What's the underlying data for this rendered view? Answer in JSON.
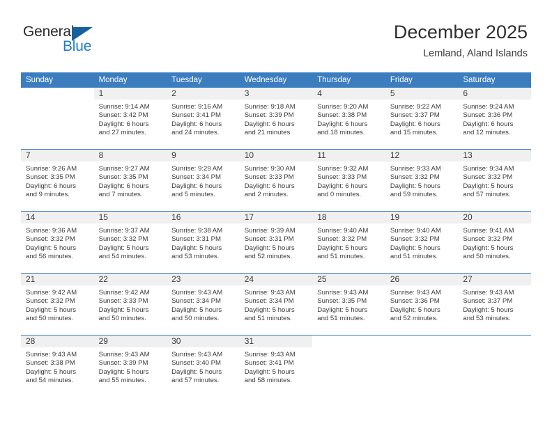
{
  "brand": {
    "name_part1": "General",
    "name_part2": "Blue",
    "triangle_color": "#17609d",
    "blue_color": "#1f7fc4"
  },
  "header": {
    "title": "December 2025",
    "subtitle": "Lemland, Aland Islands",
    "header_bg_color": "#3b7dbf"
  },
  "weekdays": [
    "Sunday",
    "Monday",
    "Tuesday",
    "Wednesday",
    "Thursday",
    "Friday",
    "Saturday"
  ],
  "weeks": [
    [
      {
        "day": ""
      },
      {
        "day": "1",
        "sunrise": "Sunrise: 9:14 AM",
        "sunset": "Sunset: 3:42 PM",
        "daylight1": "Daylight: 6 hours",
        "daylight2": "and 27 minutes."
      },
      {
        "day": "2",
        "sunrise": "Sunrise: 9:16 AM",
        "sunset": "Sunset: 3:41 PM",
        "daylight1": "Daylight: 6 hours",
        "daylight2": "and 24 minutes."
      },
      {
        "day": "3",
        "sunrise": "Sunrise: 9:18 AM",
        "sunset": "Sunset: 3:39 PM",
        "daylight1": "Daylight: 6 hours",
        "daylight2": "and 21 minutes."
      },
      {
        "day": "4",
        "sunrise": "Sunrise: 9:20 AM",
        "sunset": "Sunset: 3:38 PM",
        "daylight1": "Daylight: 6 hours",
        "daylight2": "and 18 minutes."
      },
      {
        "day": "5",
        "sunrise": "Sunrise: 9:22 AM",
        "sunset": "Sunset: 3:37 PM",
        "daylight1": "Daylight: 6 hours",
        "daylight2": "and 15 minutes."
      },
      {
        "day": "6",
        "sunrise": "Sunrise: 9:24 AM",
        "sunset": "Sunset: 3:36 PM",
        "daylight1": "Daylight: 6 hours",
        "daylight2": "and 12 minutes."
      }
    ],
    [
      {
        "day": "7",
        "sunrise": "Sunrise: 9:26 AM",
        "sunset": "Sunset: 3:35 PM",
        "daylight1": "Daylight: 6 hours",
        "daylight2": "and 9 minutes."
      },
      {
        "day": "8",
        "sunrise": "Sunrise: 9:27 AM",
        "sunset": "Sunset: 3:35 PM",
        "daylight1": "Daylight: 6 hours",
        "daylight2": "and 7 minutes."
      },
      {
        "day": "9",
        "sunrise": "Sunrise: 9:29 AM",
        "sunset": "Sunset: 3:34 PM",
        "daylight1": "Daylight: 6 hours",
        "daylight2": "and 5 minutes."
      },
      {
        "day": "10",
        "sunrise": "Sunrise: 9:30 AM",
        "sunset": "Sunset: 3:33 PM",
        "daylight1": "Daylight: 6 hours",
        "daylight2": "and 2 minutes."
      },
      {
        "day": "11",
        "sunrise": "Sunrise: 9:32 AM",
        "sunset": "Sunset: 3:33 PM",
        "daylight1": "Daylight: 6 hours",
        "daylight2": "and 0 minutes."
      },
      {
        "day": "12",
        "sunrise": "Sunrise: 9:33 AM",
        "sunset": "Sunset: 3:32 PM",
        "daylight1": "Daylight: 5 hours",
        "daylight2": "and 59 minutes."
      },
      {
        "day": "13",
        "sunrise": "Sunrise: 9:34 AM",
        "sunset": "Sunset: 3:32 PM",
        "daylight1": "Daylight: 5 hours",
        "daylight2": "and 57 minutes."
      }
    ],
    [
      {
        "day": "14",
        "sunrise": "Sunrise: 9:36 AM",
        "sunset": "Sunset: 3:32 PM",
        "daylight1": "Daylight: 5 hours",
        "daylight2": "and 56 minutes."
      },
      {
        "day": "15",
        "sunrise": "Sunrise: 9:37 AM",
        "sunset": "Sunset: 3:32 PM",
        "daylight1": "Daylight: 5 hours",
        "daylight2": "and 54 minutes."
      },
      {
        "day": "16",
        "sunrise": "Sunrise: 9:38 AM",
        "sunset": "Sunset: 3:31 PM",
        "daylight1": "Daylight: 5 hours",
        "daylight2": "and 53 minutes."
      },
      {
        "day": "17",
        "sunrise": "Sunrise: 9:39 AM",
        "sunset": "Sunset: 3:31 PM",
        "daylight1": "Daylight: 5 hours",
        "daylight2": "and 52 minutes."
      },
      {
        "day": "18",
        "sunrise": "Sunrise: 9:40 AM",
        "sunset": "Sunset: 3:32 PM",
        "daylight1": "Daylight: 5 hours",
        "daylight2": "and 51 minutes."
      },
      {
        "day": "19",
        "sunrise": "Sunrise: 9:40 AM",
        "sunset": "Sunset: 3:32 PM",
        "daylight1": "Daylight: 5 hours",
        "daylight2": "and 51 minutes."
      },
      {
        "day": "20",
        "sunrise": "Sunrise: 9:41 AM",
        "sunset": "Sunset: 3:32 PM",
        "daylight1": "Daylight: 5 hours",
        "daylight2": "and 50 minutes."
      }
    ],
    [
      {
        "day": "21",
        "sunrise": "Sunrise: 9:42 AM",
        "sunset": "Sunset: 3:32 PM",
        "daylight1": "Daylight: 5 hours",
        "daylight2": "and 50 minutes."
      },
      {
        "day": "22",
        "sunrise": "Sunrise: 9:42 AM",
        "sunset": "Sunset: 3:33 PM",
        "daylight1": "Daylight: 5 hours",
        "daylight2": "and 50 minutes."
      },
      {
        "day": "23",
        "sunrise": "Sunrise: 9:43 AM",
        "sunset": "Sunset: 3:34 PM",
        "daylight1": "Daylight: 5 hours",
        "daylight2": "and 50 minutes."
      },
      {
        "day": "24",
        "sunrise": "Sunrise: 9:43 AM",
        "sunset": "Sunset: 3:34 PM",
        "daylight1": "Daylight: 5 hours",
        "daylight2": "and 51 minutes."
      },
      {
        "day": "25",
        "sunrise": "Sunrise: 9:43 AM",
        "sunset": "Sunset: 3:35 PM",
        "daylight1": "Daylight: 5 hours",
        "daylight2": "and 51 minutes."
      },
      {
        "day": "26",
        "sunrise": "Sunrise: 9:43 AM",
        "sunset": "Sunset: 3:36 PM",
        "daylight1": "Daylight: 5 hours",
        "daylight2": "and 52 minutes."
      },
      {
        "day": "27",
        "sunrise": "Sunrise: 9:43 AM",
        "sunset": "Sunset: 3:37 PM",
        "daylight1": "Daylight: 5 hours",
        "daylight2": "and 53 minutes."
      }
    ],
    [
      {
        "day": "28",
        "sunrise": "Sunrise: 9:43 AM",
        "sunset": "Sunset: 3:38 PM",
        "daylight1": "Daylight: 5 hours",
        "daylight2": "and 54 minutes."
      },
      {
        "day": "29",
        "sunrise": "Sunrise: 9:43 AM",
        "sunset": "Sunset: 3:39 PM",
        "daylight1": "Daylight: 5 hours",
        "daylight2": "and 55 minutes."
      },
      {
        "day": "30",
        "sunrise": "Sunrise: 9:43 AM",
        "sunset": "Sunset: 3:40 PM",
        "daylight1": "Daylight: 5 hours",
        "daylight2": "and 57 minutes."
      },
      {
        "day": "31",
        "sunrise": "Sunrise: 9:43 AM",
        "sunset": "Sunset: 3:41 PM",
        "daylight1": "Daylight: 5 hours",
        "daylight2": "and 58 minutes."
      },
      {
        "day": ""
      },
      {
        "day": ""
      },
      {
        "day": ""
      }
    ]
  ]
}
